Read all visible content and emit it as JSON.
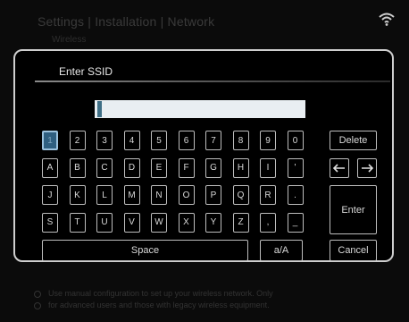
{
  "background": {
    "breadcrumb": "Settings | Installation | Network",
    "sub_item": "Wireless",
    "wifi_icon": "wifi-icon",
    "notes": [
      "Use manual configuration to set up your wireless network. Only",
      "for advanced users and those with legacy wireless equipment."
    ]
  },
  "dialog": {
    "title": "Enter SSID",
    "input_value": "",
    "selected_key": "1"
  },
  "keyboard": {
    "rows": [
      [
        "1",
        "2",
        "3",
        "4",
        "5",
        "6",
        "7",
        "8",
        "9",
        "0"
      ],
      [
        "A",
        "B",
        "C",
        "D",
        "E",
        "F",
        "G",
        "H",
        "I",
        "'"
      ],
      [
        "J",
        "K",
        "L",
        "M",
        "N",
        "O",
        "P",
        "Q",
        "R",
        "."
      ],
      [
        "S",
        "T",
        "U",
        "V",
        "W",
        "X",
        "Y",
        "Z",
        ",",
        "_"
      ]
    ],
    "space_label": "Space",
    "case_label": "a/A",
    "delete_label": "Delete",
    "enter_label": "Enter",
    "cancel_label": "Cancel",
    "left_icon": "arrow-left-icon",
    "right_icon": "arrow-right-icon"
  },
  "colors": {
    "selected_key_bg": "#2f5f80",
    "selected_key_border": "#9cc2dd",
    "input_bg": "#e9eef2"
  }
}
